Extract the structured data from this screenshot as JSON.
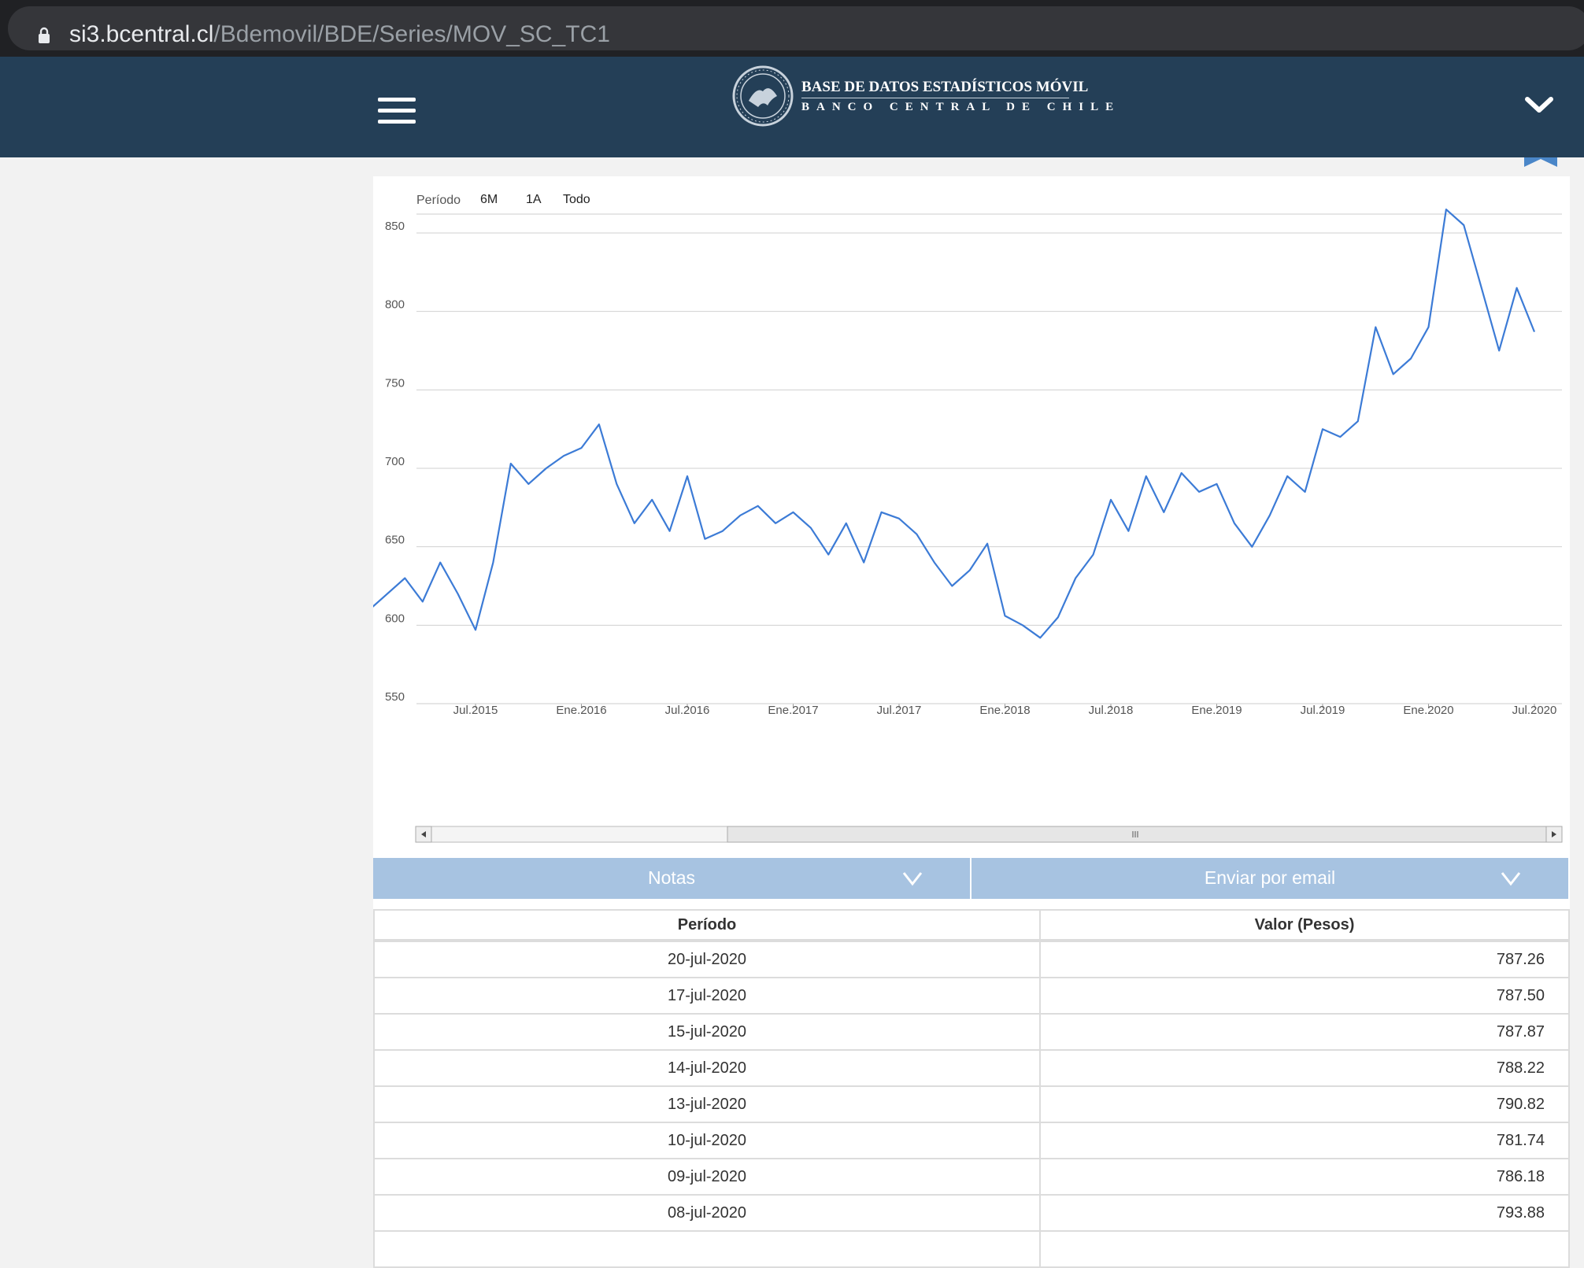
{
  "browser": {
    "host": "si3.bcentral.cl",
    "path": "/Bdemovil/BDE/Series/MOV_SC_TC1"
  },
  "header": {
    "title": "BASE DE DATOS ESTADÍSTICOS MÓVIL",
    "subtitle": "BANCO CENTRAL DE CHILE",
    "menu_icon": "hamburger-menu-icon",
    "collapse_icon": "chevron-down-icon"
  },
  "range_selector": {
    "label": "Período",
    "buttons": [
      "6M",
      "1A",
      "Todo"
    ]
  },
  "chart_data": {
    "type": "line",
    "y_ticks": [
      "850",
      "800",
      "750",
      "700",
      "650",
      "600",
      "550"
    ],
    "x_ticks": [
      "Jul.2015",
      "Ene.2016",
      "Jul.2016",
      "Ene.2017",
      "Jul.2017",
      "Ene.2018",
      "Jul.2018",
      "Ene.2019",
      "Jul.2019",
      "Ene.2020",
      "Jul.2020"
    ],
    "ylim": [
      550,
      850
    ],
    "x_range": [
      "Ene.2015",
      "Jul.2020"
    ],
    "grid": true,
    "line_color": "#3c7bd6",
    "series": [
      {
        "x": [
          "Ene.2015",
          "Mar.2015",
          "Abr.2015",
          "May.2015",
          "Jun.2015",
          "Jul.2015",
          "Ago.2015",
          "Sep.2015",
          "Oct.2015",
          "Nov.2015",
          "Dic.2015",
          "Ene.2016",
          "Feb.2016",
          "Mar.2016",
          "Abr.2016",
          "May.2016",
          "Jun.2016",
          "Jul.2016",
          "Ago.2016",
          "Sep.2016",
          "Oct.2016",
          "Nov.2016",
          "Dic.2016",
          "Ene.2017",
          "Feb.2017",
          "Mar.2017",
          "Abr.2017",
          "May.2017",
          "Jun.2017",
          "Jul.2017",
          "Ago.2017",
          "Sep.2017",
          "Oct.2017",
          "Nov.2017",
          "Dic.2017",
          "Ene.2018",
          "Feb.2018",
          "Mar.2018",
          "Abr.2018",
          "May.2018",
          "Jun.2018",
          "Jul.2018",
          "Ago.2018",
          "Sep.2018",
          "Oct.2018",
          "Nov.2018",
          "Dic.2018",
          "Ene.2019",
          "Feb.2019",
          "Mar.2019",
          "Abr.2019",
          "May.2019",
          "Jun.2019",
          "Jul.2019",
          "Ago.2019",
          "Sep.2019",
          "Oct.2019",
          "Nov.2019",
          "Dic.2019",
          "Ene.2020",
          "Feb.2020",
          "Mar.2020",
          "Abr.2020",
          "May.2020",
          "Jun.2020",
          "Jul.2020"
        ],
        "values": [
          610,
          630,
          615,
          640,
          620,
          597,
          640,
          703,
          690,
          700,
          708,
          713,
          728,
          690,
          665,
          680,
          660,
          695,
          655,
          660,
          670,
          676,
          665,
          672,
          662,
          645,
          665,
          640,
          672,
          668,
          658,
          640,
          625,
          635,
          652,
          606,
          600,
          592,
          605,
          630,
          645,
          680,
          660,
          695,
          672,
          697,
          685,
          690,
          665,
          650,
          670,
          695,
          685,
          725,
          720,
          730,
          790,
          760,
          770,
          790,
          865,
          855,
          815,
          775,
          815,
          787
        ]
      }
    ]
  },
  "accordions": {
    "notas": "Notas",
    "email": "Enviar por email"
  },
  "table": {
    "headers": [
      "Período",
      "Valor (Pesos)"
    ],
    "rows": [
      [
        "20-jul-2020",
        "787.26"
      ],
      [
        "17-jul-2020",
        "787.50"
      ],
      [
        "15-jul-2020",
        "787.87"
      ],
      [
        "14-jul-2020",
        "788.22"
      ],
      [
        "13-jul-2020",
        "790.82"
      ],
      [
        "10-jul-2020",
        "781.74"
      ],
      [
        "09-jul-2020",
        "786.18"
      ],
      [
        "08-jul-2020",
        "793.88"
      ],
      [
        "",
        ""
      ]
    ]
  }
}
